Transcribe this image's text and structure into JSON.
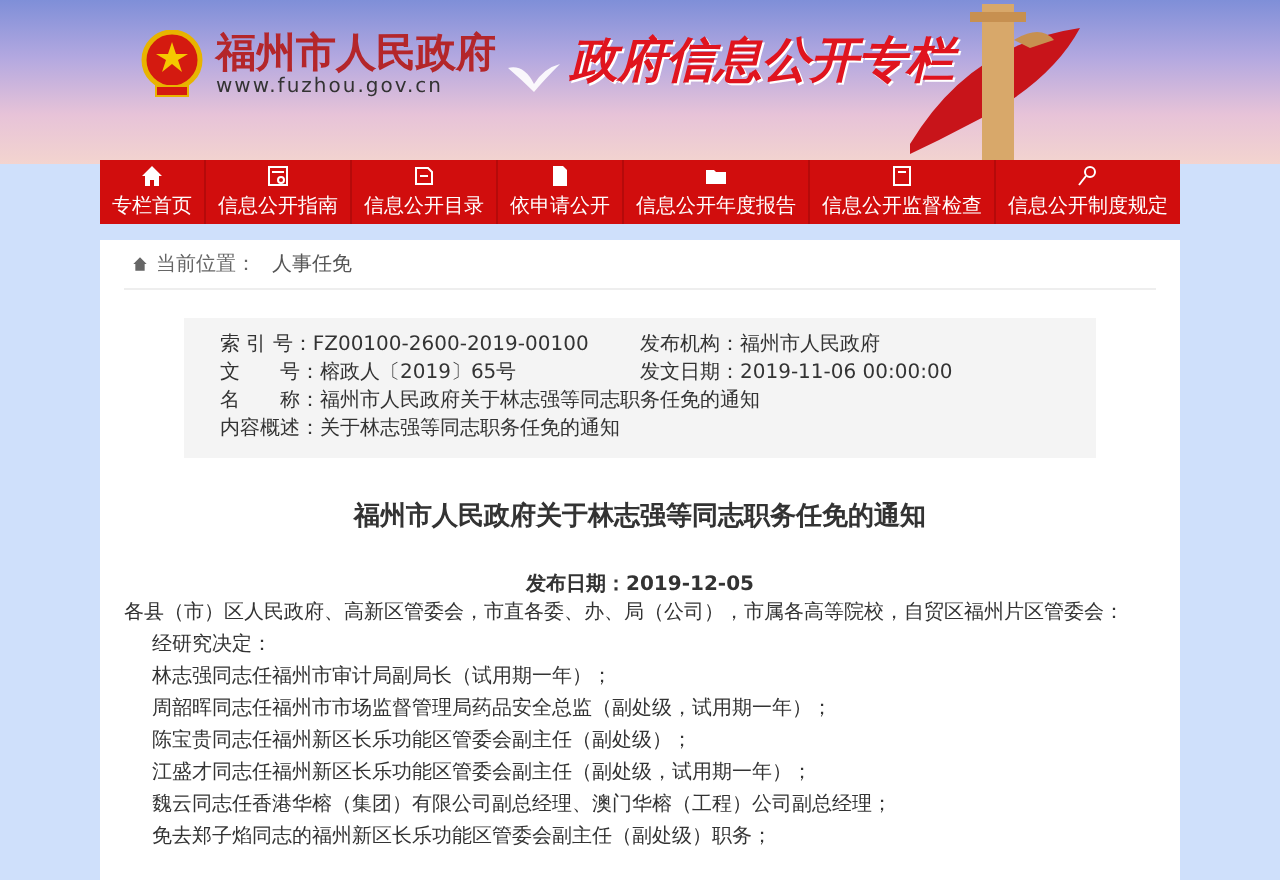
{
  "header": {
    "site_name": "福州市人民政府",
    "url": "www.fuzhou.gov.cn",
    "slogan": "政府信息公开专栏"
  },
  "nav": [
    {
      "label": "专栏首页"
    },
    {
      "label": "信息公开指南"
    },
    {
      "label": "信息公开目录"
    },
    {
      "label": "依申请公开"
    },
    {
      "label": "信息公开年度报告"
    },
    {
      "label": "信息公开监督检查"
    },
    {
      "label": "信息公开制度规定"
    }
  ],
  "breadcrumb": {
    "label": "当前位置：",
    "current": "人事任免"
  },
  "info": {
    "rows": [
      [
        {
          "label": "索 引 号：",
          "value": "FZ00100-2600-2019-00100"
        },
        {
          "label": "发布机构：",
          "value": "福州市人民政府"
        }
      ],
      [
        {
          "label": "文　　号：",
          "value": "榕政人〔2019〕65号"
        },
        {
          "label": "发文日期：",
          "value": "2019-11-06 00:00:00"
        }
      ],
      [
        {
          "label": "名　　称：",
          "value": "福州市人民政府关于林志强等同志职务任免的通知"
        }
      ],
      [
        {
          "label": "内容概述：",
          "value": "关于林志强等同志职务任免的通知"
        }
      ]
    ]
  },
  "article": {
    "title": "福州市人民政府关于林志强等同志职务任免的通知",
    "date": "发布日期：2019-12-05",
    "paragraphs": [
      {
        "kind": "salutation",
        "text": "各县（市）区人民政府、高新区管委会，市直各委、办、局（公司），市属各高等院校，自贸区福州片区管委会："
      },
      {
        "kind": "body",
        "text": "经研究决定："
      },
      {
        "kind": "body",
        "text": "林志强同志任福州市审计局副局长（试用期一年）；"
      },
      {
        "kind": "body",
        "text": "周韶晖同志任福州市市场监督管理局药品安全总监（副处级，试用期一年）；"
      },
      {
        "kind": "body",
        "text": "陈宝贵同志任福州新区长乐功能区管委会副主任（副处级）；"
      },
      {
        "kind": "body",
        "text": "江盛才同志任福州新区长乐功能区管委会副主任（副处级，试用期一年）；"
      },
      {
        "kind": "body",
        "text": "魏云同志任香港华榕（集团）有限公司副总经理、澳门华榕（工程）公司副总经理；"
      },
      {
        "kind": "body",
        "text": "免去郑子焰同志的福州新区长乐功能区管委会副主任（副处级）职务；"
      }
    ]
  }
}
